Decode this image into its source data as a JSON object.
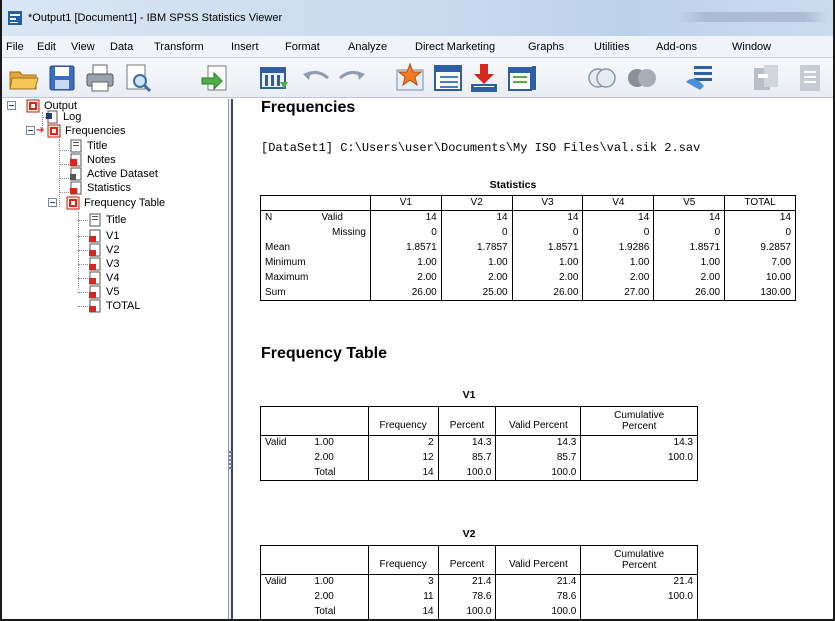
{
  "window": {
    "title": "*Output1 [Document1] - IBM SPSS Statistics Viewer"
  },
  "menu": [
    "File",
    "Edit",
    "View",
    "Data",
    "Transform",
    "Insert",
    "Format",
    "Analyze",
    "Direct Marketing",
    "Graphs",
    "Utilities",
    "Add-ons",
    "Window"
  ],
  "toolbar": [
    "open-icon",
    "save-icon",
    "print-icon",
    "print-preview-icon",
    "export-icon",
    "go-to-data-icon",
    "undo-icon",
    "redo-icon",
    "go-to-case-icon",
    "go-to-variable-icon",
    "variables-icon",
    "select-cases-icon",
    "show-all-variables-icon",
    "use-variable-sets-icon",
    "designate-window-icon",
    "insert-output-icon",
    "insert-page-break-icon"
  ],
  "outline": {
    "root": "Output",
    "log": "Log",
    "frequencies": "Frequencies",
    "title": "Title",
    "notes": "Notes",
    "active_dataset": "Active Dataset",
    "statistics": "Statistics",
    "frequency_table": "Frequency Table",
    "ft_title": "Title",
    "items": [
      "V1",
      "V2",
      "V3",
      "V4",
      "V5",
      "TOTAL"
    ]
  },
  "content": {
    "heading": "Frequencies",
    "dataset_line": "[DataSet1] C:\\Users\\user\\Documents\\My ISO Files\\val.sik 2.sav",
    "statistics": {
      "caption": "Statistics",
      "columns": [
        "V1",
        "V2",
        "V3",
        "V4",
        "V5",
        "TOTAL"
      ],
      "rows": [
        {
          "label": "N",
          "sub": "Valid",
          "values": [
            "14",
            "14",
            "14",
            "14",
            "14",
            "14"
          ]
        },
        {
          "label": "",
          "sub": "Missing",
          "values": [
            "0",
            "0",
            "0",
            "0",
            "0",
            "0"
          ]
        },
        {
          "label": "Mean",
          "sub": "",
          "values": [
            "1.8571",
            "1.7857",
            "1.8571",
            "1.9286",
            "1.8571",
            "9.2857"
          ]
        },
        {
          "label": "Minimum",
          "sub": "",
          "values": [
            "1.00",
            "1.00",
            "1.00",
            "1.00",
            "1.00",
            "7.00"
          ]
        },
        {
          "label": "Maximum",
          "sub": "",
          "values": [
            "2.00",
            "2.00",
            "2.00",
            "2.00",
            "2.00",
            "10.00"
          ]
        },
        {
          "label": "Sum",
          "sub": "",
          "values": [
            "26.00",
            "25.00",
            "26.00",
            "27.00",
            "26.00",
            "130.00"
          ]
        }
      ]
    },
    "freq_heading": "Frequency Table",
    "freq_columns": [
      "Frequency",
      "Percent",
      "Valid Percent",
      "Cumulative",
      "Percent"
    ],
    "v1": {
      "caption": "V1",
      "rows": [
        {
          "g": "Valid",
          "v": "1.00",
          "f": "2",
          "p": "14.3",
          "vp": "14.3",
          "cp": "14.3"
        },
        {
          "g": "",
          "v": "2.00",
          "f": "12",
          "p": "85.7",
          "vp": "85.7",
          "cp": "100.0"
        },
        {
          "g": "",
          "v": "Total",
          "f": "14",
          "p": "100.0",
          "vp": "100.0",
          "cp": ""
        }
      ]
    },
    "v2": {
      "caption": "V2",
      "rows": [
        {
          "g": "Valid",
          "v": "1.00",
          "f": "3",
          "p": "21.4",
          "vp": "21.4",
          "cp": "21.4"
        },
        {
          "g": "",
          "v": "2.00",
          "f": "11",
          "p": "78.6",
          "vp": "78.6",
          "cp": "100.0"
        },
        {
          "g": "",
          "v": "Total",
          "f": "14",
          "p": "100.0",
          "vp": "100.0",
          "cp": ""
        }
      ]
    }
  }
}
